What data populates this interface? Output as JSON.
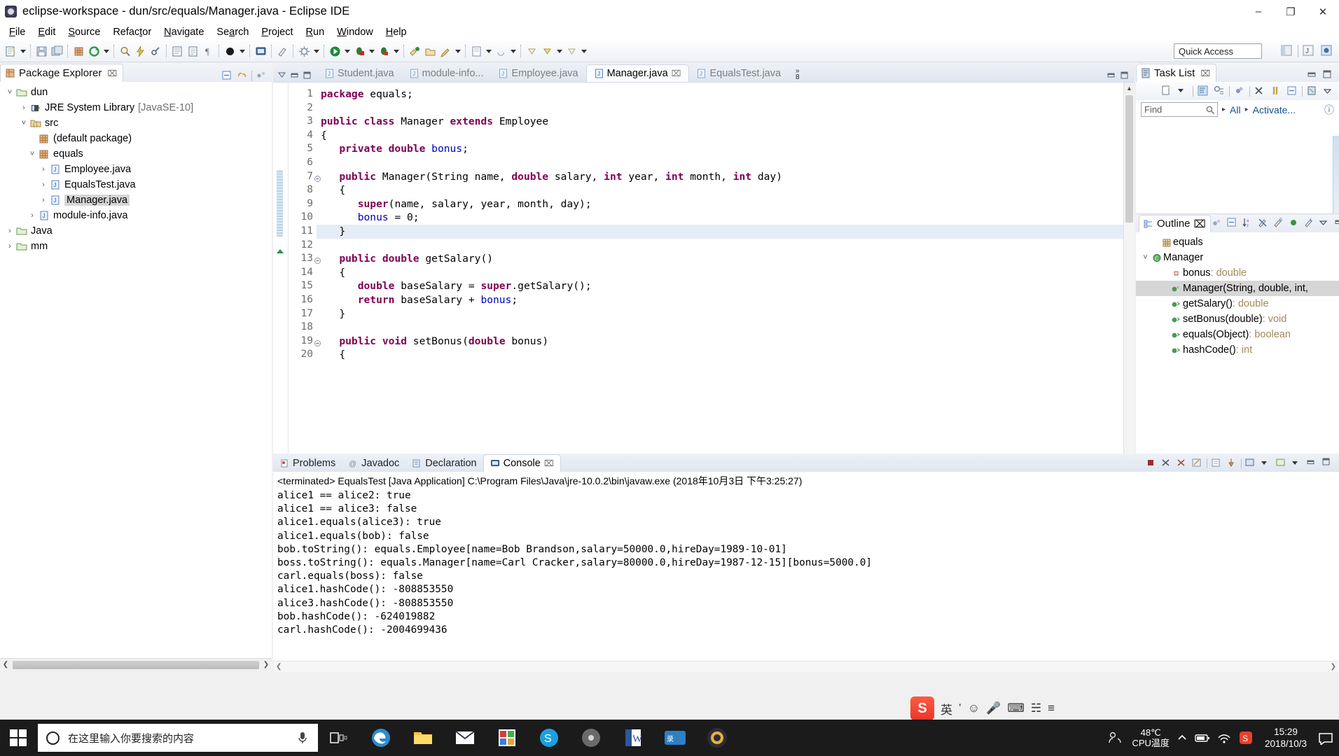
{
  "window": {
    "title": "eclipse-workspace - dun/src/equals/Manager.java - Eclipse IDE",
    "minimize": "–",
    "maximize": "❐",
    "close": "✕"
  },
  "menubar": [
    {
      "label": "File",
      "mnemonic": "F"
    },
    {
      "label": "Edit",
      "mnemonic": "E"
    },
    {
      "label": "Source",
      "mnemonic": "S"
    },
    {
      "label": "Refactor",
      "mnemonic": "t"
    },
    {
      "label": "Navigate",
      "mnemonic": "N"
    },
    {
      "label": "Search",
      "mnemonic": "a"
    },
    {
      "label": "Project",
      "mnemonic": "P"
    },
    {
      "label": "Run",
      "mnemonic": "R"
    },
    {
      "label": "Window",
      "mnemonic": "W"
    },
    {
      "label": "Help",
      "mnemonic": "H"
    }
  ],
  "toolbar": {
    "quick_access_label": "Quick Access",
    "icons": [
      "new-wizard-icon",
      "save-icon",
      "save-all-icon",
      "new-java-package-icon",
      "refresh-icon",
      "search-icon",
      "quick-fix-icon",
      "link-icon",
      "build-all-icon",
      "toggle-mark-occurrences-icon",
      "pilcrow-icon",
      "skip-breakpoints-icon",
      "open-task-icon",
      "debug-icon",
      "run-icon",
      "run-last-tool-icon",
      "coverage-icon",
      "external-tools-icon",
      "open-type-icon",
      "new-class-icon",
      "search-type-icon",
      "next-annotation-icon",
      "previous-annotation-icon",
      "back-icon",
      "forward-icon"
    ]
  },
  "package_explorer": {
    "title": "Package Explorer",
    "close_glyph": "⌧",
    "tools": [
      "collapse-all-icon",
      "link-with-editor-icon",
      "view-menu-icon"
    ],
    "tree": [
      {
        "label": "dun",
        "sub": "",
        "indent": 0,
        "twist": "v",
        "icon": "java-project-icon",
        "selected": false
      },
      {
        "label": "JRE System Library",
        "sub": "[JavaSE-10]",
        "indent": 1,
        "twist": ">",
        "icon": "library-icon",
        "selected": false
      },
      {
        "label": "src",
        "sub": "",
        "indent": 1,
        "twist": "v",
        "icon": "source-folder-icon",
        "selected": false
      },
      {
        "label": "(default package)",
        "sub": "",
        "indent": 2,
        "twist": "",
        "icon": "package-icon",
        "selected": false
      },
      {
        "label": "equals",
        "sub": "",
        "indent": 2,
        "twist": "v",
        "icon": "package-icon",
        "selected": false
      },
      {
        "label": "Employee.java",
        "sub": "",
        "indent": 3,
        "twist": ">",
        "icon": "java-file-icon",
        "selected": false
      },
      {
        "label": "EqualsTest.java",
        "sub": "",
        "indent": 3,
        "twist": ">",
        "icon": "java-file-icon",
        "selected": false
      },
      {
        "label": "Manager.java",
        "sub": "",
        "indent": 3,
        "twist": ">",
        "icon": "java-file-icon",
        "selected": true
      },
      {
        "label": "module-info.java",
        "sub": "",
        "indent": 2,
        "twist": ">",
        "icon": "java-file-icon",
        "selected": false
      },
      {
        "label": "Java",
        "sub": "",
        "indent": 0,
        "twist": ">",
        "icon": "java-project-icon",
        "selected": false
      },
      {
        "label": "mm",
        "sub": "",
        "indent": 0,
        "twist": ">",
        "icon": "java-project-icon",
        "selected": false
      }
    ]
  },
  "editor": {
    "tabs": [
      {
        "label": "Student.java",
        "active": false,
        "closable": false
      },
      {
        "label": "module-info...",
        "active": false,
        "closable": false
      },
      {
        "label": "Employee.java",
        "active": false,
        "closable": false
      },
      {
        "label": "Manager.java",
        "active": true,
        "closable": true
      },
      {
        "label": "EqualsTest.java",
        "active": false,
        "closable": false
      }
    ],
    "overflow_chevron": "»",
    "overflow_count": "8",
    "close_glyph": "⌧",
    "lines": [
      {
        "n": 1,
        "fold": "",
        "text": "package equals;",
        "current": false,
        "tokens": [
          {
            "t": "package",
            "c": "kw"
          },
          {
            "t": " equals;",
            "c": "plain"
          }
        ]
      },
      {
        "n": 2,
        "fold": "",
        "text": "",
        "current": false,
        "tokens": []
      },
      {
        "n": 3,
        "fold": "",
        "text": "public class Manager extends Employee",
        "current": false,
        "tokens": [
          {
            "t": "public class",
            "c": "kw"
          },
          {
            "t": " Manager ",
            "c": "plain"
          },
          {
            "t": "extends",
            "c": "kw"
          },
          {
            "t": " Employee",
            "c": "plain"
          }
        ]
      },
      {
        "n": 4,
        "fold": "",
        "text": "{",
        "current": false,
        "tokens": [
          {
            "t": "{",
            "c": "plain"
          }
        ]
      },
      {
        "n": 5,
        "fold": "",
        "text": "   private double bonus;",
        "current": false,
        "tokens": [
          {
            "t": "   ",
            "c": "plain"
          },
          {
            "t": "private double",
            "c": "kw"
          },
          {
            "t": " ",
            "c": "plain"
          },
          {
            "t": "bonus",
            "c": "fld"
          },
          {
            "t": ";",
            "c": "plain"
          }
        ]
      },
      {
        "n": 6,
        "fold": "",
        "text": "",
        "current": false,
        "tokens": []
      },
      {
        "n": 7,
        "fold": "-",
        "text": "   public Manager(String name, double salary, int year, int month, int day)",
        "current": false,
        "tokens": [
          {
            "t": "   ",
            "c": "plain"
          },
          {
            "t": "public",
            "c": "kw"
          },
          {
            "t": " Manager(String name, ",
            "c": "plain"
          },
          {
            "t": "double",
            "c": "kw"
          },
          {
            "t": " salary, ",
            "c": "plain"
          },
          {
            "t": "int",
            "c": "kw"
          },
          {
            "t": " year, ",
            "c": "plain"
          },
          {
            "t": "int",
            "c": "kw"
          },
          {
            "t": " month, ",
            "c": "plain"
          },
          {
            "t": "int",
            "c": "kw"
          },
          {
            "t": " day)",
            "c": "plain"
          }
        ]
      },
      {
        "n": 8,
        "fold": "",
        "text": "   {",
        "current": false,
        "tokens": [
          {
            "t": "   {",
            "c": "plain"
          }
        ]
      },
      {
        "n": 9,
        "fold": "",
        "text": "      super(name, salary, year, month, day);",
        "current": false,
        "tokens": [
          {
            "t": "      ",
            "c": "plain"
          },
          {
            "t": "super",
            "c": "kw"
          },
          {
            "t": "(name, salary, year, month, day);",
            "c": "plain"
          }
        ]
      },
      {
        "n": 10,
        "fold": "",
        "text": "      bonus = 0;",
        "current": false,
        "tokens": [
          {
            "t": "      ",
            "c": "plain"
          },
          {
            "t": "bonus",
            "c": "fld"
          },
          {
            "t": " = 0;",
            "c": "plain"
          }
        ]
      },
      {
        "n": 11,
        "fold": "",
        "text": "   }",
        "current": true,
        "tokens": [
          {
            "t": "   }",
            "c": "plain"
          }
        ]
      },
      {
        "n": 12,
        "fold": "",
        "text": "",
        "current": false,
        "tokens": []
      },
      {
        "n": 13,
        "fold": "-",
        "text": "   public double getSalary()",
        "current": false,
        "tokens": [
          {
            "t": "   ",
            "c": "plain"
          },
          {
            "t": "public double",
            "c": "kw"
          },
          {
            "t": " getSalary()",
            "c": "plain"
          }
        ]
      },
      {
        "n": 14,
        "fold": "",
        "text": "   {",
        "current": false,
        "tokens": [
          {
            "t": "   {",
            "c": "plain"
          }
        ]
      },
      {
        "n": 15,
        "fold": "",
        "text": "      double baseSalary = super.getSalary();",
        "current": false,
        "tokens": [
          {
            "t": "      ",
            "c": "plain"
          },
          {
            "t": "double",
            "c": "kw"
          },
          {
            "t": " baseSalary = ",
            "c": "plain"
          },
          {
            "t": "super",
            "c": "kw"
          },
          {
            "t": ".getSalary();",
            "c": "plain"
          }
        ]
      },
      {
        "n": 16,
        "fold": "",
        "text": "      return baseSalary + bonus;",
        "current": false,
        "tokens": [
          {
            "t": "      ",
            "c": "plain"
          },
          {
            "t": "return",
            "c": "kw"
          },
          {
            "t": " baseSalary + ",
            "c": "plain"
          },
          {
            "t": "bonus",
            "c": "fld"
          },
          {
            "t": ";",
            "c": "plain"
          }
        ]
      },
      {
        "n": 17,
        "fold": "",
        "text": "   }",
        "current": false,
        "tokens": [
          {
            "t": "   }",
            "c": "plain"
          }
        ]
      },
      {
        "n": 18,
        "fold": "",
        "text": "",
        "current": false,
        "tokens": []
      },
      {
        "n": 19,
        "fold": "-",
        "text": "   public void setBonus(double bonus)",
        "current": false,
        "tokens": [
          {
            "t": "   ",
            "c": "plain"
          },
          {
            "t": "public void",
            "c": "kw"
          },
          {
            "t": " setBonus(",
            "c": "plain"
          },
          {
            "t": "double",
            "c": "kw"
          },
          {
            "t": " bonus)",
            "c": "plain"
          }
        ]
      },
      {
        "n": 20,
        "fold": "",
        "text": "   {",
        "current": false,
        "tokens": [
          {
            "t": "   {",
            "c": "plain"
          }
        ]
      }
    ]
  },
  "task_list": {
    "title": "Task List",
    "close_glyph": "⌧",
    "find_placeholder": "Find",
    "filter_all": "All",
    "filter_activate": "Activate...",
    "help_glyph": "?",
    "tools": [
      "new-task-icon",
      "dropdown-icon",
      "categorized-icon",
      "scheduled-icon",
      "focus-on-workweek-icon",
      "delete-icon",
      "restore-icon",
      "collapse-all-icon",
      "synchronize-icon",
      "view-menu-icon"
    ]
  },
  "outline": {
    "title": "Outline",
    "close_glyph": "⌧",
    "tools": [
      "focus-icon",
      "collapse-all-icon",
      "sort-icon",
      "hide-fields-icon",
      "hide-static-icon",
      "hide-nonpublic-icon",
      "hide-local-types-icon",
      "view-menu-icon",
      "minimize-icon",
      "maximize-icon"
    ],
    "items": [
      {
        "name": "equals",
        "type": "",
        "icon": "package-icon",
        "indent": 1,
        "twist": "",
        "selected": false
      },
      {
        "name": "Manager",
        "type": "",
        "icon": "class-icon",
        "indent": 0,
        "twist": "v",
        "selected": false
      },
      {
        "name": "bonus",
        "type": " : double",
        "icon": "private-field-icon",
        "indent": 2,
        "twist": "",
        "selected": false
      },
      {
        "name": "Manager(String, double, int,",
        "type": "",
        "icon": "constructor-icon",
        "indent": 2,
        "twist": "",
        "selected": true
      },
      {
        "name": "getSalary()",
        "type": " : double",
        "icon": "public-method-icon",
        "indent": 2,
        "twist": "",
        "selected": false
      },
      {
        "name": "setBonus(double)",
        "type": " : void",
        "icon": "public-method-icon",
        "indent": 2,
        "twist": "",
        "selected": false
      },
      {
        "name": "equals(Object)",
        "type": " : boolean",
        "icon": "public-method-icon",
        "indent": 2,
        "twist": "",
        "selected": false
      },
      {
        "name": "hashCode()",
        "type": " : int",
        "icon": "public-method-icon",
        "indent": 2,
        "twist": "",
        "selected": false
      }
    ]
  },
  "console": {
    "tabs": [
      {
        "label": "Problems",
        "icon": "problems-icon",
        "active": false
      },
      {
        "label": "Javadoc",
        "icon": "javadoc-icon",
        "active": false
      },
      {
        "label": "Declaration",
        "icon": "declaration-icon",
        "active": false
      },
      {
        "label": "Console",
        "icon": "console-icon",
        "active": true
      }
    ],
    "close_glyph": "⌧",
    "tools": [
      "terminate-icon",
      "remove-launch-icon",
      "remove-all-icon",
      "clear-console-icon",
      "scroll-lock-icon",
      "pin-console-icon",
      "display-selected-icon",
      "open-console-icon",
      "view-menu-icon",
      "minimize-icon",
      "maximize-icon"
    ],
    "header": "<terminated> EqualsTest [Java Application] C:\\Program Files\\Java\\jre-10.0.2\\bin\\javaw.exe (2018年10月3日 下午3:25:27)",
    "output": [
      "alice1 == alice2: true",
      "alice1 == alice3: false",
      "alice1.equals(alice3): true",
      "alice1.equals(bob): false",
      "bob.toString(): equals.Employee[name=Bob Brandson,salary=50000.0,hireDay=1989-10-01]",
      "boss.toString(): equals.Manager[name=Carl Cracker,salary=80000.0,hireDay=1987-12-15][bonus=5000.0]",
      "carl.equals(boss): false",
      "alice1.hashCode(): -808853550",
      "alice3.hashCode(): -808853550",
      "bob.hashCode(): -624019882",
      "carl.hashCode(): -2004699436"
    ]
  },
  "ime": {
    "logo": "S",
    "language": "英",
    "items": [
      "punctuation-icon",
      "emoji-icon",
      "mic-icon",
      "keyboard-icon",
      "toolbox-icon",
      "menu-icon"
    ]
  },
  "taskbar": {
    "search_placeholder": "在这里输入你要搜索的内容",
    "apps": [
      "task-view-icon",
      "edge-icon",
      "file-explorer-icon",
      "mail-icon",
      "store-icon",
      "skype-icon",
      "media-icon",
      "word-icon",
      "recorder-icon",
      "eclipse-icon"
    ],
    "people_icon": "people-icon",
    "cpu_temp_value": "48℃",
    "cpu_temp_label": "CPU温度",
    "tray_icons": [
      "chevron-up-icon",
      "battery-icon",
      "network-icon",
      "sogou-icon"
    ],
    "clock_time": "15:29",
    "clock_date": "2018/10/3",
    "notification_icon": "notification-icon"
  },
  "colors": {
    "keyword": "#7f0055",
    "field": "#0000c0",
    "link": "#13528f",
    "selection": "#d6d6d6",
    "current_line": "#e4ecf7",
    "accent": "#e81123"
  }
}
